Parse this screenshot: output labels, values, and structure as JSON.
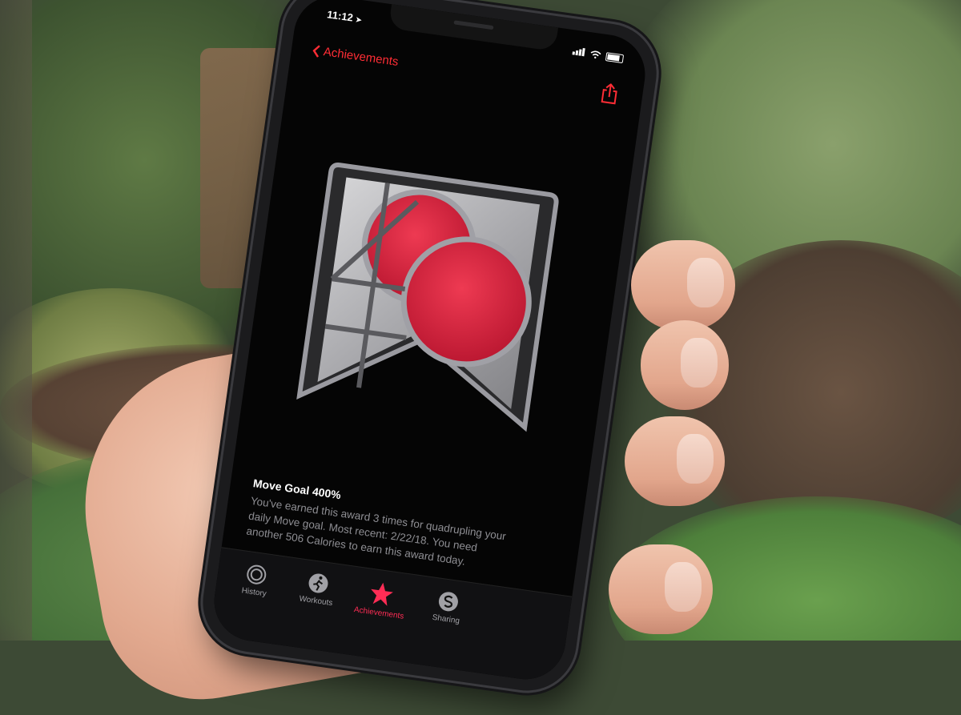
{
  "status_bar": {
    "time": "11:12",
    "location_icon": "location-arrow-icon"
  },
  "nav": {
    "back_label": "Achievements",
    "back_icon": "chevron-left-icon",
    "share_icon": "share-icon"
  },
  "award": {
    "badge_icon": "move-goal-400-badge",
    "title": "Move Goal 400%",
    "description": "You've earned this award 3 times for quadrupling your daily Move goal. Most recent: 2/22/18. You need another 506 Calories to earn this award today."
  },
  "tabs": [
    {
      "label": "History",
      "icon": "history-ring-icon",
      "active": false
    },
    {
      "label": "Workouts",
      "icon": "running-figure-icon",
      "active": false
    },
    {
      "label": "Achievements",
      "icon": "star-achievement-icon",
      "active": true
    },
    {
      "label": "Sharing",
      "icon": "sharing-icon",
      "active": false
    }
  ],
  "colors": {
    "accent": "#ff2d35",
    "badge_red": "#d91e3a",
    "background": "#050505"
  }
}
